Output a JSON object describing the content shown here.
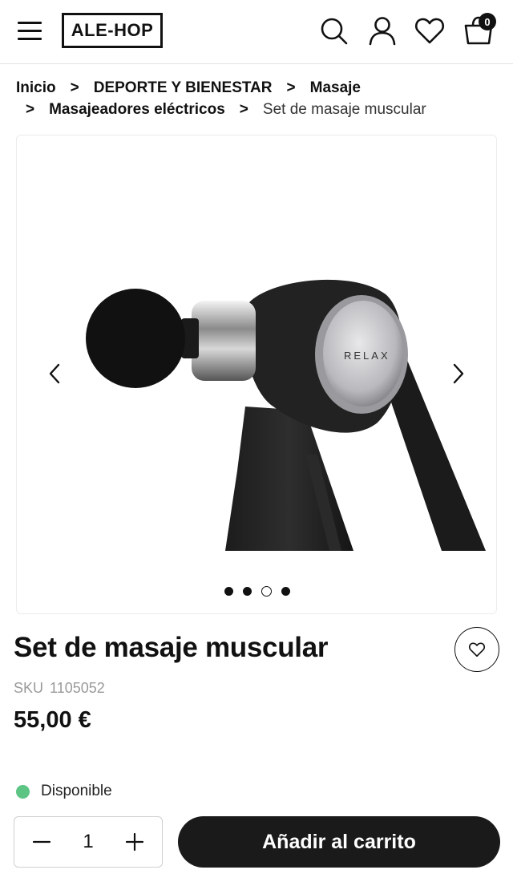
{
  "header": {
    "logo_text": "ALE-HOP",
    "menu_icon": "hamburger-menu-icon",
    "search_icon": "search-icon",
    "account_icon": "user-icon",
    "wishlist_icon": "heart-icon",
    "cart_icon": "shopping-bag-icon",
    "cart_count": "0"
  },
  "breadcrumb": {
    "items": [
      "Inicio",
      "DEPORTE Y BIENESTAR",
      "Masaje",
      "Masajeadores eléctricos"
    ],
    "separator": ">",
    "current": "Set de masaje muscular"
  },
  "gallery": {
    "image_brand_text": "RELAX",
    "prev_icon": "chevron-left-icon",
    "next_icon": "chevron-right-icon",
    "slide_count": 4,
    "active_slide": 3
  },
  "product": {
    "title": "Set de masaje muscular",
    "sku_label": "SKU",
    "sku_value": "1105052",
    "price": "55,00 €",
    "availability": "Disponible",
    "availability_color": "#5cc584",
    "quantity": "1",
    "add_to_cart_label": "Añadir al carrito"
  },
  "colors": {
    "primary": "#1a1a1a",
    "text": "#111111",
    "muted": "#9a9a9a"
  }
}
